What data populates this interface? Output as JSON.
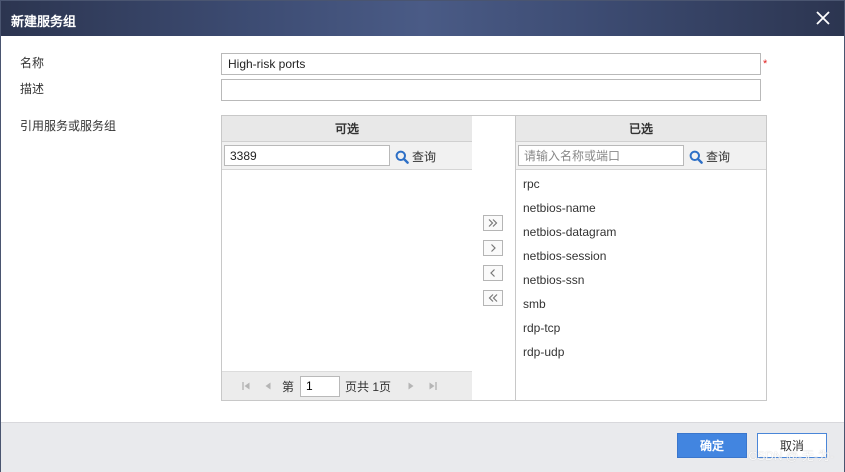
{
  "dialog": {
    "title": "新建服务组"
  },
  "form": {
    "name_label": "名称",
    "name_value": "High-risk ports",
    "required_mark": "*",
    "desc_label": "描述",
    "desc_value": "",
    "ref_label": "引用服务或服务组"
  },
  "available": {
    "header": "可选",
    "search_value": "3389",
    "search_placeholder": "",
    "search_button": "查询",
    "items": [],
    "pager": {
      "prefix": "第",
      "page": "1",
      "suffix": "页共 1页"
    }
  },
  "selected": {
    "header": "已选",
    "search_value": "",
    "search_placeholder": "请输入名称或端口",
    "search_button": "查询",
    "items": [
      "rpc",
      "netbios-name",
      "netbios-datagram",
      "netbios-session",
      "netbios-ssn",
      "smb",
      "rdp-tcp",
      "rdp-udp"
    ]
  },
  "transfer": {
    "add_all": "»",
    "add": "›",
    "remove": "‹",
    "remove_all": "«"
  },
  "footer": {
    "ok_label": "确定",
    "cancel_label": "取消",
    "watermark": "CSDN @-无-为-"
  },
  "colors": {
    "primary": "#4285e0",
    "search_icon": "#2d6fc6",
    "required": "#e02020"
  }
}
